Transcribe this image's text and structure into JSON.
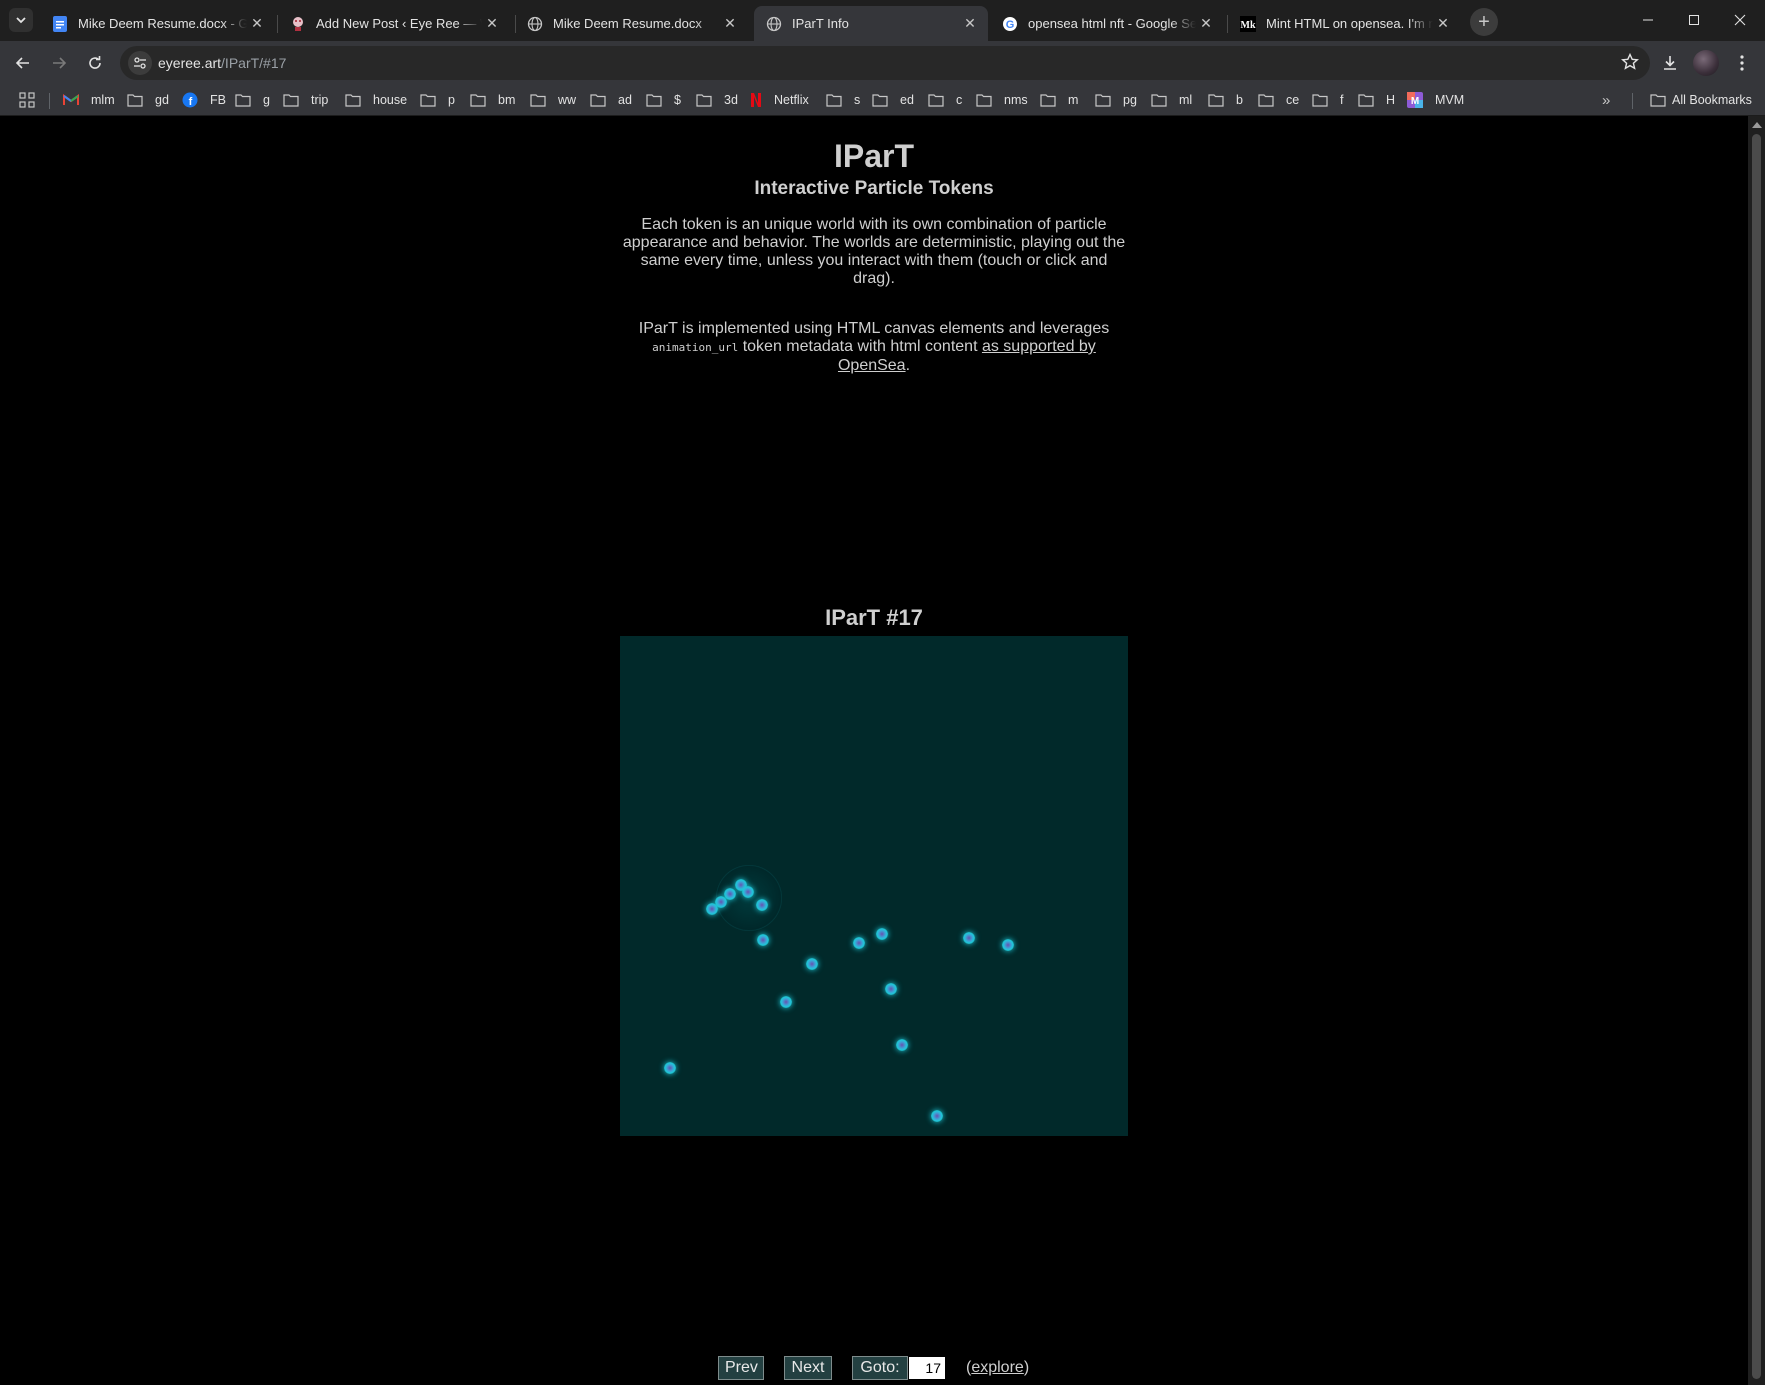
{
  "browser": {
    "tabs": [
      {
        "title": "Mike Deem Resume.docx - Goo",
        "favicon": "google-docs-icon",
        "active": false
      },
      {
        "title": "Add New Post ‹ Eye Ree — Wor",
        "favicon": "wordpress-site-icon",
        "active": false
      },
      {
        "title": "Mike Deem Resume.docx",
        "favicon": "globe-icon",
        "active": false
      },
      {
        "title": "IParT Info",
        "favicon": "globe-icon",
        "active": true
      },
      {
        "title": "opensea html nft - Google Sear",
        "favicon": "google-icon",
        "active": false
      },
      {
        "title": "Mint HTML on opensea. I'm not",
        "favicon": "medium-icon",
        "active": false
      }
    ],
    "address": {
      "host": "eyeree.art",
      "path": "/IParT/#17"
    },
    "bookmarks": [
      {
        "label": "mlm",
        "icon": "gmail-icon"
      },
      {
        "label": "gd",
        "icon": "folder-icon"
      },
      {
        "label": "FB",
        "icon": "facebook-icon"
      },
      {
        "label": "g",
        "icon": "folder-icon"
      },
      {
        "label": "trip",
        "icon": "folder-icon"
      },
      {
        "label": "house",
        "icon": "folder-icon"
      },
      {
        "label": "p",
        "icon": "folder-icon"
      },
      {
        "label": "bm",
        "icon": "folder-icon"
      },
      {
        "label": "ww",
        "icon": "folder-icon"
      },
      {
        "label": "ad",
        "icon": "folder-icon"
      },
      {
        "label": "$",
        "icon": "folder-icon"
      },
      {
        "label": "3d",
        "icon": "folder-icon"
      },
      {
        "label": "Netflix",
        "icon": "netflix-icon"
      },
      {
        "label": "s",
        "icon": "folder-icon"
      },
      {
        "label": "ed",
        "icon": "folder-icon"
      },
      {
        "label": "c",
        "icon": "folder-icon"
      },
      {
        "label": "nms",
        "icon": "folder-icon"
      },
      {
        "label": "m",
        "icon": "folder-icon"
      },
      {
        "label": "pg",
        "icon": "folder-icon"
      },
      {
        "label": "ml",
        "icon": "folder-icon"
      },
      {
        "label": "b",
        "icon": "folder-icon"
      },
      {
        "label": "ce",
        "icon": "folder-icon"
      },
      {
        "label": "f",
        "icon": "folder-icon"
      },
      {
        "label": "H",
        "icon": "folder-icon"
      },
      {
        "label": "MVM",
        "icon": "mvm-icon"
      }
    ],
    "all_bookmarks_label": "All Bookmarks"
  },
  "page": {
    "title": "IParT",
    "subtitle": "Interactive Particle Tokens",
    "intro": "Each token is an unique world with its own combination of particle appearance and behavior. The worlds are deterministic, playing out the same every time, unless you interact with them (touch or click and drag).",
    "impl_before": "IParT is implemented using HTML canvas elements and leverages ",
    "impl_code": "animation_url",
    "impl_middle": " token metadata with html content ",
    "impl_link": "as supported by OpenSea",
    "impl_after": ".",
    "token_title": "IParT #17",
    "canvas_color": "#01292a",
    "particle_color": "#1ec8d8",
    "nav": {
      "prev_label": "Prev",
      "next_label": "Next",
      "goto_label": "Goto:",
      "goto_value": "17",
      "explore_open": "(",
      "explore_label": "explore",
      "explore_close": ")"
    }
  },
  "colors": {
    "tabstrip": "#1f1f1f",
    "toolbar": "#35363a",
    "page_background": "#000000",
    "button_background": "#234041"
  }
}
